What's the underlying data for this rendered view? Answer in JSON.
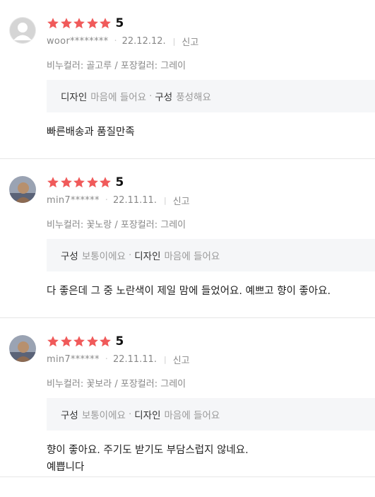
{
  "colors": {
    "star": "#f05a5a",
    "text": "#222222",
    "muted": "#888888",
    "box_bg": "#f5f6f8",
    "divider": "#e6e6e6"
  },
  "reviews": [
    {
      "rating": "5",
      "avatar": "default-avatar",
      "user": "woor********",
      "date": "22.12.12.",
      "report": "신고",
      "options": "비누컬러: 골고루 / 포장컬러: 그레이",
      "evals": [
        {
          "key": "디자인",
          "value": "마음에 들어요"
        },
        {
          "key": "구성",
          "value": "풍성해요"
        }
      ],
      "content": [
        "빠른배송과 품질만족"
      ]
    },
    {
      "rating": "5",
      "avatar": "photo-avatar",
      "user": "min7******",
      "date": "22.11.11.",
      "report": "신고",
      "options": "비누컬러: 꽃노랑 / 포장컬러: 그레이",
      "evals": [
        {
          "key": "구성",
          "value": "보통이에요"
        },
        {
          "key": "디자인",
          "value": "마음에 들어요"
        }
      ],
      "content": [
        "다 좋은데 그 중 노란색이 제일 맘에 들었어요. 예쁘고 향이 좋아요."
      ]
    },
    {
      "rating": "5",
      "avatar": "photo-avatar",
      "user": "min7******",
      "date": "22.11.11.",
      "report": "신고",
      "options": "비누컬러: 꽃보라 / 포장컬러: 그레이",
      "evals": [
        {
          "key": "구성",
          "value": "보통이에요"
        },
        {
          "key": "디자인",
          "value": "마음에 들어요"
        }
      ],
      "content": [
        "향이 좋아요. 주기도 받기도 부담스럽지 않네요.",
        "예쁩니다"
      ]
    }
  ]
}
